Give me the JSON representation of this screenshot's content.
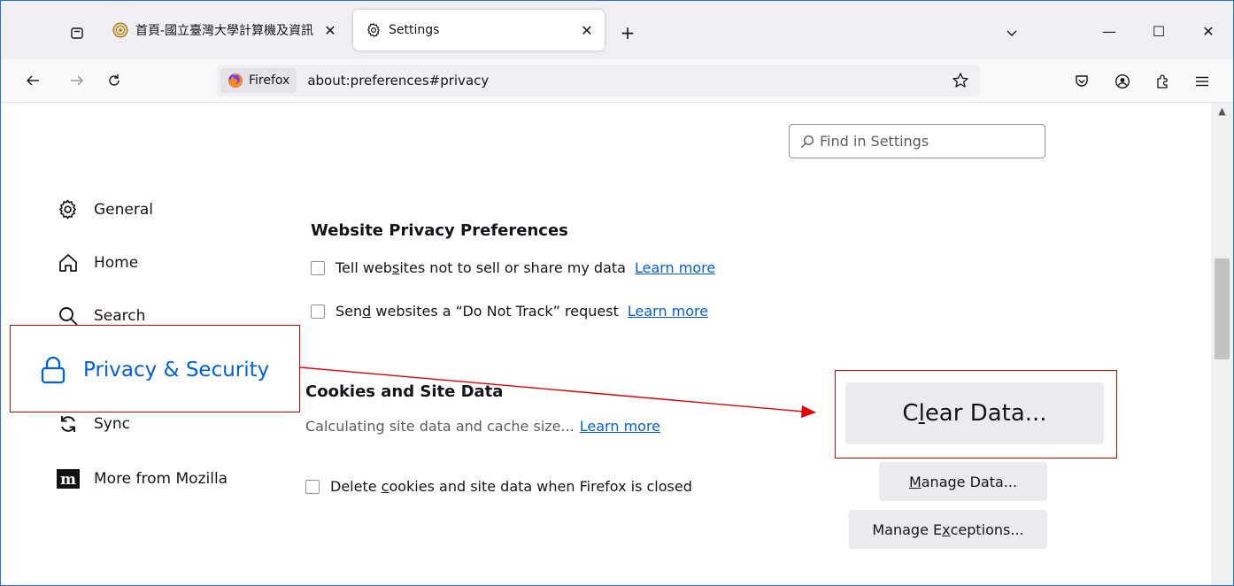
{
  "colors": {
    "accent": "#0061e0",
    "annotation": "#e60000",
    "frame": "#2b6fd6"
  },
  "tabs": [
    {
      "title": "首頁-國立臺灣大學計算機及資訊",
      "favicon": "ntu-seal-icon",
      "active": false
    },
    {
      "title": "Settings",
      "favicon": "gear-icon",
      "active": true
    }
  ],
  "window": {
    "minimize": "—",
    "maximize": "☐",
    "close": "✕"
  },
  "urlbar": {
    "identity_label": "Firefox",
    "url": "about:preferences#privacy"
  },
  "search": {
    "placeholder": "Find in Settings"
  },
  "sidebar": {
    "items": [
      {
        "label": "General",
        "icon": "gear-icon"
      },
      {
        "label": "Home",
        "icon": "home-icon"
      },
      {
        "label": "Search",
        "icon": "search-icon"
      },
      {
        "label": "Privacy & Security",
        "icon": "lock-icon",
        "active": true
      },
      {
        "label": "Sync",
        "icon": "sync-icon"
      },
      {
        "label": "More from Mozilla",
        "icon": "mozilla-m-icon"
      }
    ]
  },
  "privacy_prefs": {
    "title": "Website Privacy Preferences",
    "sell_share": {
      "pre": "Tell web",
      "accel": "s",
      "post": "ites not to sell or share my data",
      "link": "Learn more"
    },
    "dnt": {
      "pre": "Sen",
      "accel": "d",
      "post": " websites a “Do Not Track” request",
      "link": "Learn more"
    }
  },
  "cookies": {
    "title": "Cookies and Site Data",
    "status": "Calculating site data and cache size...",
    "status_link": "Learn more",
    "delete_on_close": {
      "pre": "Delete ",
      "accel": "c",
      "post": "ookies and site data when Firefox is closed"
    },
    "clear_button": {
      "pre": "C",
      "accel": "l",
      "post": "ear Data..."
    },
    "manage_button": {
      "pre": "",
      "accel": "M",
      "post": "anage Data..."
    },
    "exceptions_button": {
      "pre": "Manage E",
      "accel": "x",
      "post": "ceptions..."
    }
  }
}
